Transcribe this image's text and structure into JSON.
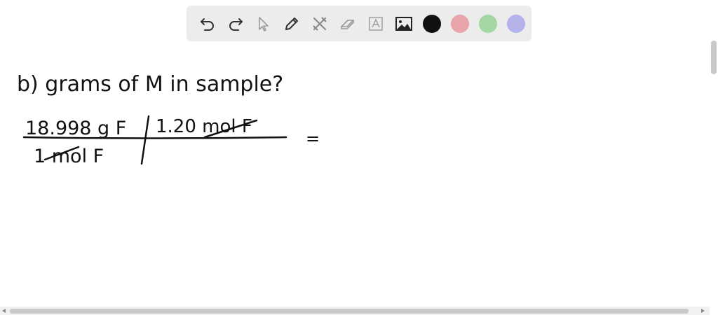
{
  "toolbar": {
    "tools": [
      {
        "name": "undo-icon",
        "label": "Undo"
      },
      {
        "name": "redo-icon",
        "label": "Redo"
      },
      {
        "name": "select-pointer-icon",
        "label": "Select"
      },
      {
        "name": "pen-icon",
        "label": "Pen"
      },
      {
        "name": "tools-icon",
        "label": "Tools"
      },
      {
        "name": "eraser-icon",
        "label": "Eraser"
      },
      {
        "name": "text-icon",
        "label": "Text"
      },
      {
        "name": "image-icon",
        "label": "Image"
      }
    ],
    "colors": [
      "#111111",
      "#e8a3ab",
      "#a3d6a3",
      "#b3b3ea"
    ]
  },
  "canvas": {
    "line1": "b) grams of  M  in sample?",
    "numerator_left": "18.998 g  F",
    "numerator_right": "1.20  mol F",
    "denominator_left": "1 mol F",
    "equals": "="
  }
}
